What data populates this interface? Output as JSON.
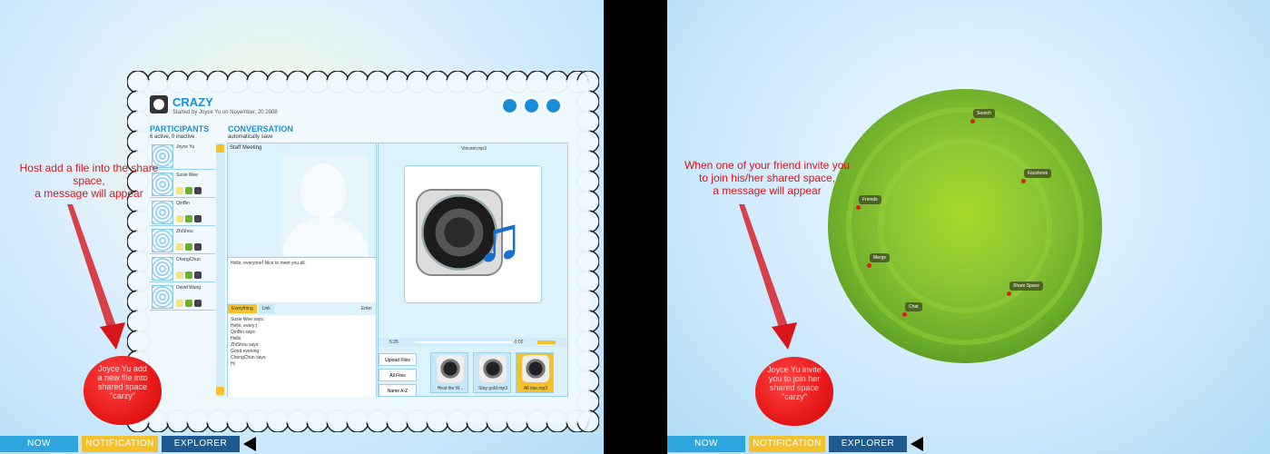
{
  "nav": {
    "now": "NOW",
    "notification": "NOTIFICATION",
    "explorer": "EXPLORER"
  },
  "space": {
    "title": "CRAZY",
    "subtitle": "Started by Joyce Yu on November, 20 2008",
    "participants_heading": "PARTICIPANTS",
    "participants_sub": "6 active, 0 inactive",
    "conversation_heading": "CONVERSATION",
    "conversation_sub": "automatically save",
    "participants": [
      {
        "name": "Joyce Yu"
      },
      {
        "name": "Susie Wee"
      },
      {
        "name": "QinBin"
      },
      {
        "name": "ZhiShou"
      },
      {
        "name": "ChengChun"
      },
      {
        "name": "David Wang"
      }
    ],
    "staff_meeting": "Staff Meeting",
    "message": "Hello, everyone! Nice to meet you all.",
    "filters": {
      "everything": "Everything",
      "link": "Link",
      "enter": "Enter"
    },
    "chat_log": [
      "Susie Wee says:",
      "Hello, every:)",
      "QinBin says:",
      "Hello",
      "ZhiShou says:",
      "Good evening",
      "ChengChun says:",
      "Hi"
    ],
    "media_title": "Vincent.mp3",
    "time_elapsed": "5:35",
    "time_remaining": "-0:00",
    "file_buttons": [
      "Upload Files",
      "All Files",
      "Name A-Z"
    ],
    "files": [
      {
        "label": "Heal the W...",
        "selected": false
      },
      {
        "label": "Stay gold.mp3",
        "selected": false
      },
      {
        "label": "All rise.mp3",
        "selected": true
      }
    ]
  },
  "left_annotation": "Host add a file into the share space,\na message will appear",
  "left_bubble": "Joyce Yu add\na new file into\nshared space\n\"carzy\"",
  "right_annotation": "When one of your friend invite you\nto join his/her shared space,\na message will appear",
  "right_bubble": "Joyce Yu invite\nyou to join her\nshared space\n\"carzy\"",
  "globe_items": {
    "search": "Search",
    "facebook": "Facebook",
    "friends": "Friends",
    "merge": "Merge",
    "share_space": "Share Space",
    "chat": "Chat"
  },
  "colors": {
    "accent_blue": "#1a8fd8",
    "notify_yellow": "#f4c12a",
    "alert_red": "#d8151b",
    "explorer_navy": "#1e5a92"
  }
}
